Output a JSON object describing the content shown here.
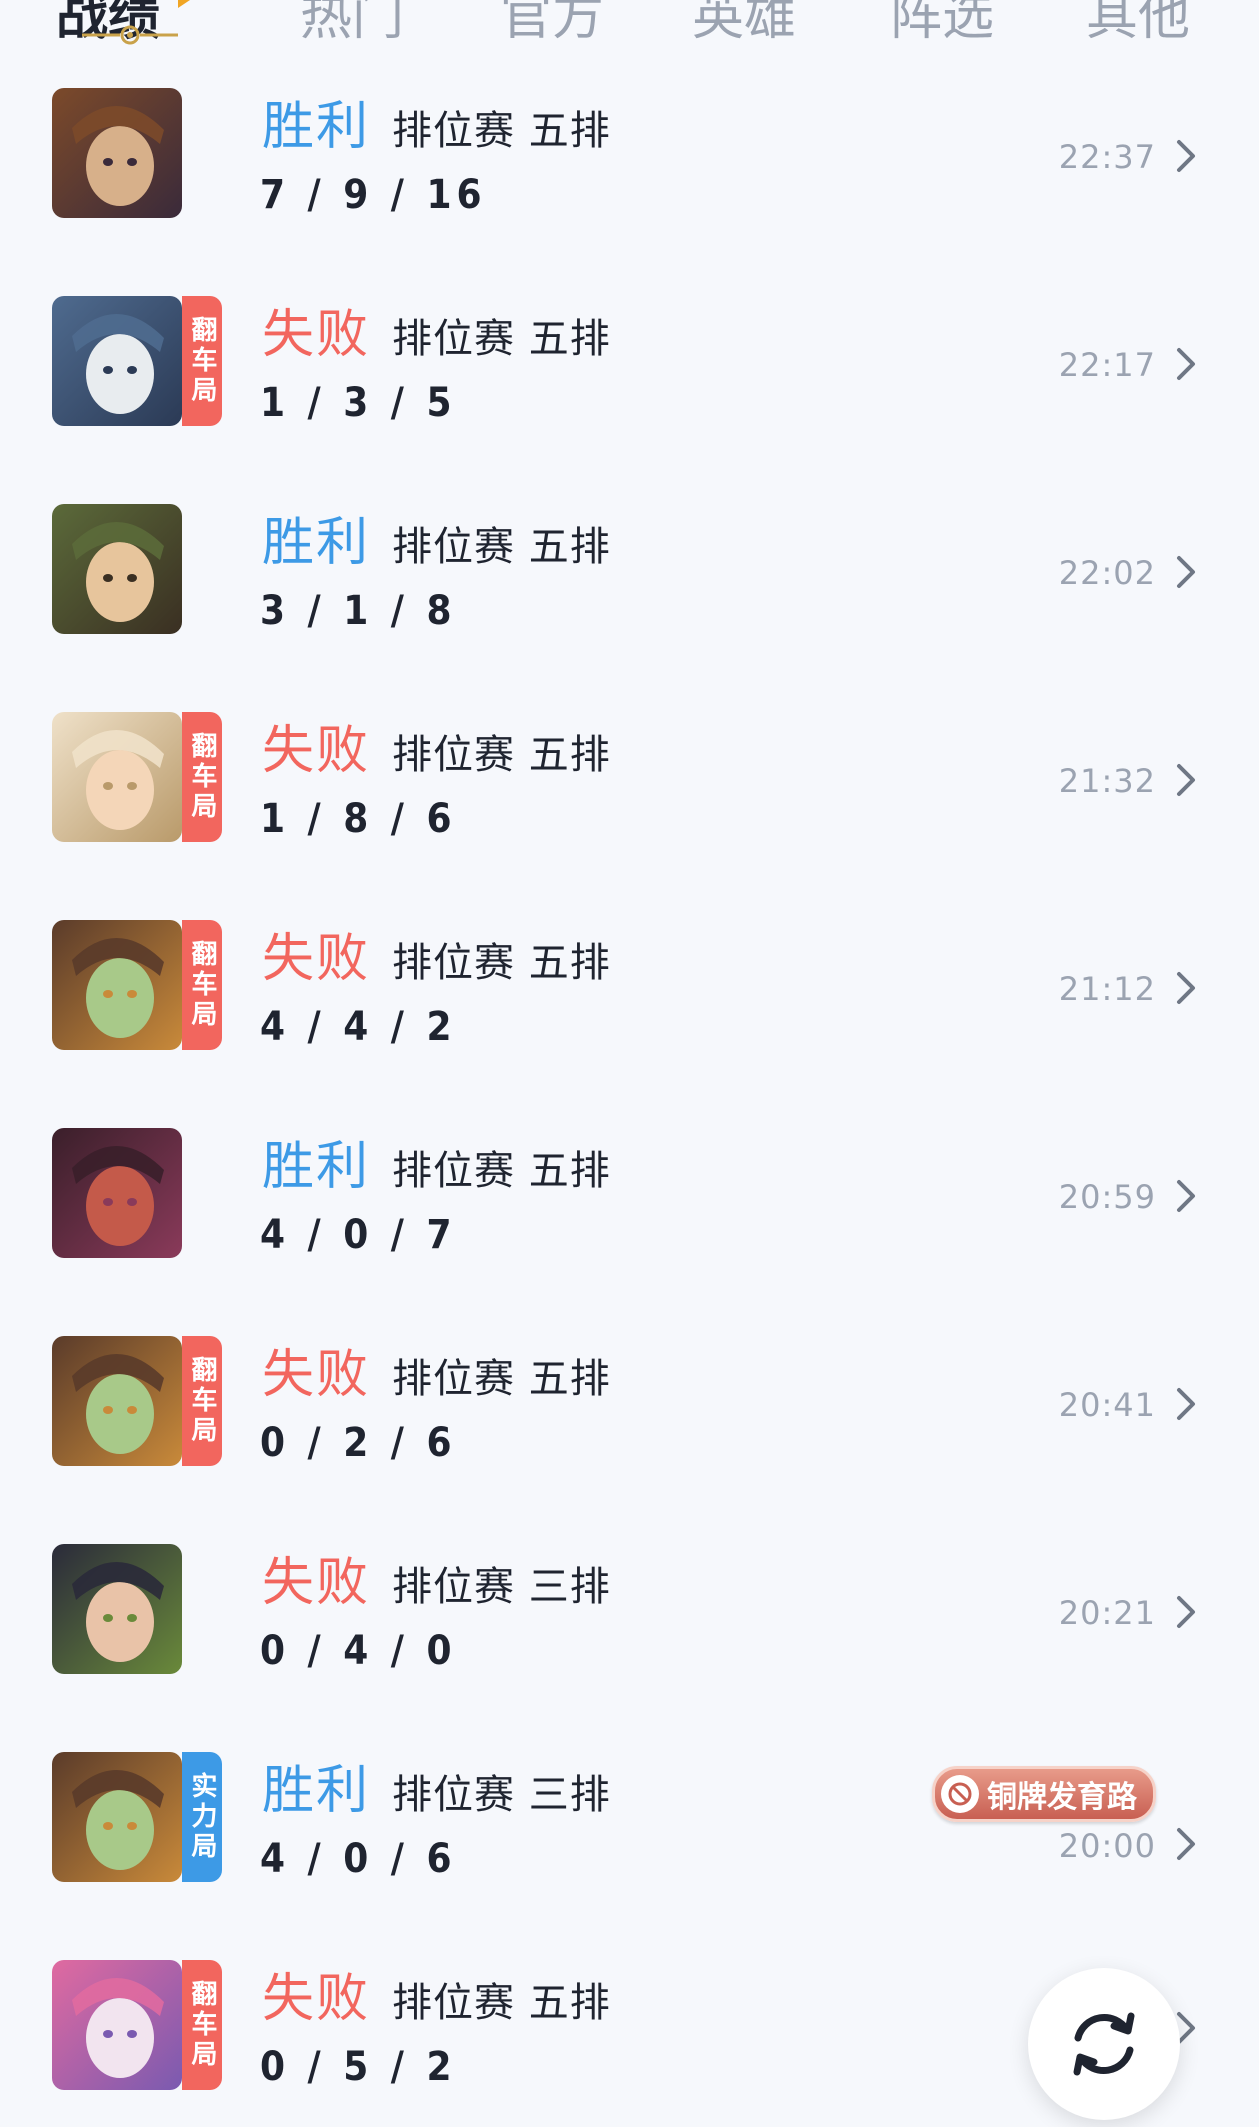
{
  "tabs": [
    {
      "label": "战绩",
      "active": true
    },
    {
      "label": "热门",
      "active": false
    },
    {
      "label": "官方",
      "active": false
    },
    {
      "label": "英雄",
      "active": false
    },
    {
      "label": "阵选",
      "active": false
    },
    {
      "label": "其他",
      "active": false
    }
  ],
  "matches": [
    {
      "result": "胜利",
      "win": true,
      "mode": "排位赛 五排",
      "kda": "7 / 9 / 16",
      "time": "22:37",
      "tag": "",
      "hero_colors": [
        "#7c4a2a",
        "#d7b08a",
        "#3a2a3a"
      ]
    },
    {
      "result": "失败",
      "win": false,
      "mode": "排位赛 五排",
      "kda": "1 / 3 / 5",
      "time": "22:17",
      "tag": "翻车局",
      "hero_colors": [
        "#4f6b8f",
        "#e8ecef",
        "#2b3a55"
      ]
    },
    {
      "result": "胜利",
      "win": true,
      "mode": "排位赛 五排",
      "kda": "3 / 1 / 8",
      "time": "22:02",
      "tag": "",
      "hero_colors": [
        "#5b6a3a",
        "#e7c59c",
        "#3a2f22"
      ]
    },
    {
      "result": "失败",
      "win": false,
      "mode": "排位赛 五排",
      "kda": "1 / 8 / 6",
      "time": "21:32",
      "tag": "翻车局",
      "hero_colors": [
        "#efe1c9",
        "#f4d6b8",
        "#b99a6a"
      ]
    },
    {
      "result": "失败",
      "win": false,
      "mode": "排位赛 五排",
      "kda": "4 / 4 / 2",
      "time": "21:12",
      "tag": "翻车局",
      "hero_colors": [
        "#5a3b2a",
        "#a8c989",
        "#c98a3a"
      ]
    },
    {
      "result": "胜利",
      "win": true,
      "mode": "排位赛 五排",
      "kda": "4 / 0 / 7",
      "time": "20:59",
      "tag": "",
      "hero_colors": [
        "#3a1f2a",
        "#c45a4a",
        "#8a3a5a"
      ]
    },
    {
      "result": "失败",
      "win": false,
      "mode": "排位赛 五排",
      "kda": "0 / 2 / 6",
      "time": "20:41",
      "tag": "翻车局",
      "hero_colors": [
        "#5a3b2a",
        "#a8c989",
        "#c98a3a"
      ]
    },
    {
      "result": "失败",
      "win": false,
      "mode": "排位赛 三排",
      "kda": "0 / 4 / 0",
      "time": "20:21",
      "tag": "",
      "hero_colors": [
        "#2a2a3a",
        "#e9c3a8",
        "#6a8a3a"
      ]
    },
    {
      "result": "胜利",
      "win": true,
      "mode": "排位赛 三排",
      "kda": "4 / 0 / 6",
      "time": "20:00",
      "tag": "实力局",
      "badge": "铜牌发育路",
      "hero_colors": [
        "#5a3b2a",
        "#a8c989",
        "#c98a3a"
      ]
    },
    {
      "result": "失败",
      "win": false,
      "mode": "排位赛 五排",
      "kda": "0 / 5 / 2",
      "time": "",
      "tag": "翻车局",
      "hero_colors": [
        "#e06aa0",
        "#f2e4ef",
        "#7a5ab0"
      ]
    }
  ],
  "colors": {
    "win": "#3d9ae6",
    "lose": "#f2665e",
    "text": "#1f2430",
    "muted": "#9ba3b1",
    "background": "#f6f8fc"
  },
  "fab": {
    "icon": "refresh-icon"
  }
}
